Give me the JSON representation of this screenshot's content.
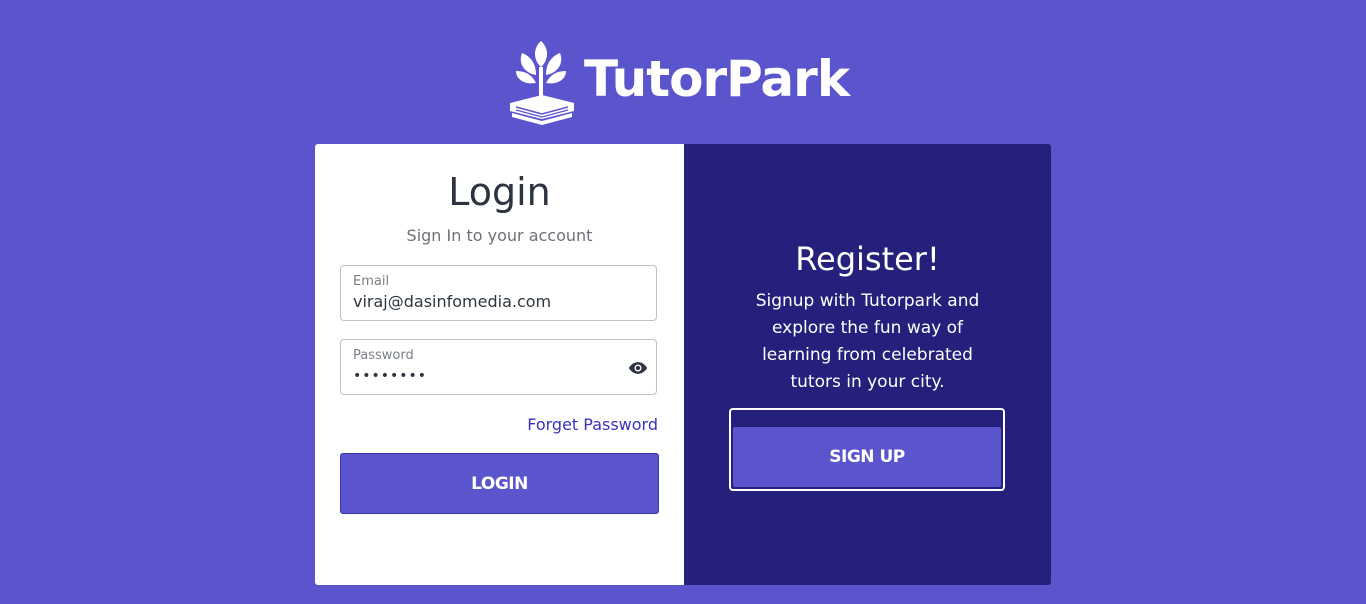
{
  "brand": {
    "name": "TutorPark",
    "logo_icon": "tree-book-icon"
  },
  "login": {
    "title": "Login",
    "subtitle": "Sign In to your account",
    "email_label": "Email",
    "email_value": "viraj@dasinfomedia.com",
    "password_label": "Password",
    "password_masked": "••••••••",
    "forget_password": "Forget Password",
    "button_label": "LOGIN"
  },
  "register": {
    "title": "Register!",
    "description": "Signup with Tutorpark and explore the fun way of learning from celebrated tutors in your city.",
    "button_label": "SIGN UP"
  },
  "colors": {
    "background": "#5b55cd",
    "register_panel": "#25207b",
    "button": "#5b55cd",
    "link": "#3a31c0"
  }
}
